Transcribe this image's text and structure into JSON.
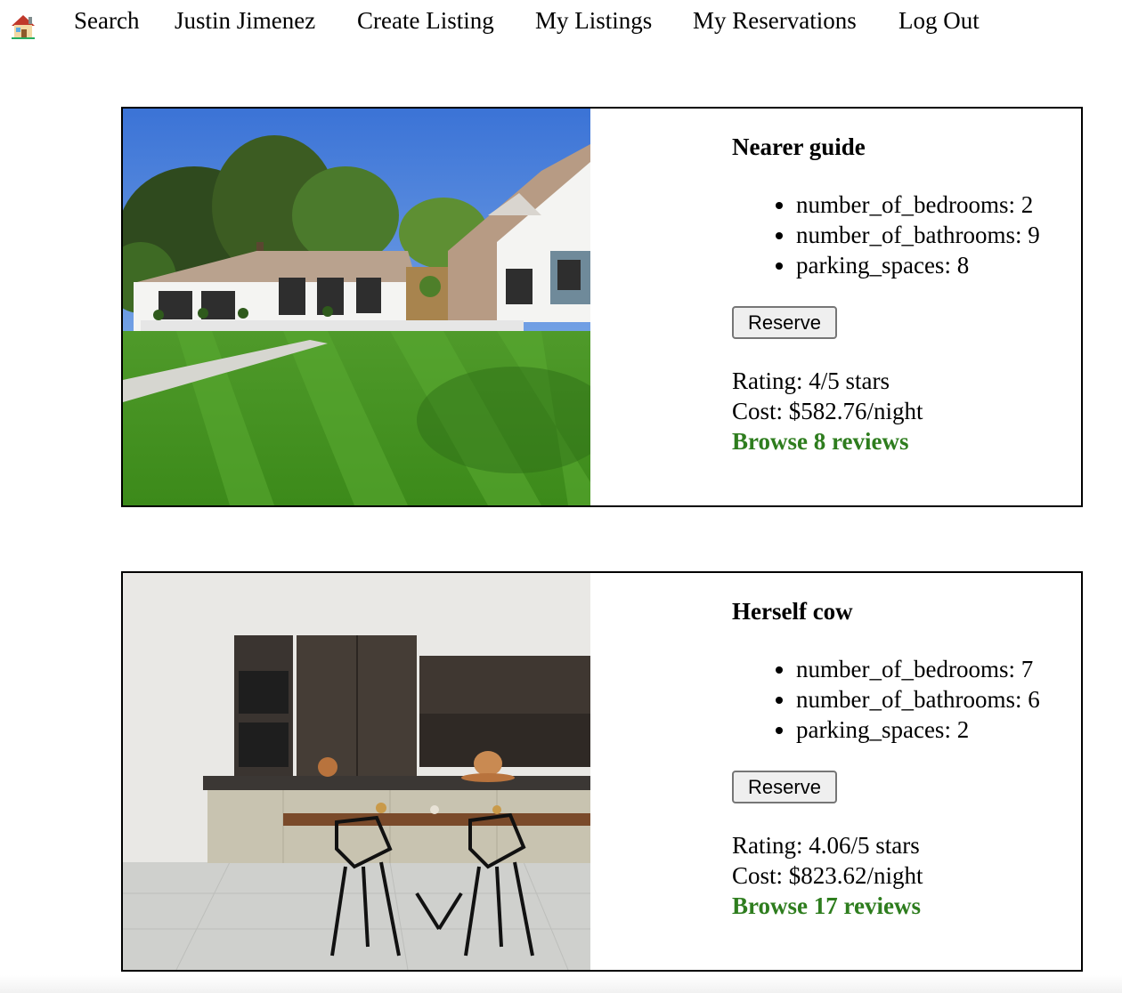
{
  "nav": {
    "home_icon": "house-emoji-icon",
    "items": [
      {
        "label": "Search"
      },
      {
        "label": "Justin Jimenez"
      },
      {
        "label": "Create Listing"
      },
      {
        "label": "My Listings"
      },
      {
        "label": "My Reservations"
      },
      {
        "label": "Log Out"
      }
    ]
  },
  "listings": [
    {
      "image": "house-with-lawn-photo",
      "title": "Nearer guide",
      "features": [
        "number_of_bedrooms: 2",
        "number_of_bathrooms: 9",
        "parking_spaces: 8"
      ],
      "reserve_label": "Reserve",
      "rating": "Rating: 4/5 stars",
      "cost": "Cost: $582.76/night",
      "reviews_link": "Browse 8 reviews"
    },
    {
      "image": "kitchen-interior-photo",
      "title": "Herself cow",
      "features": [
        "number_of_bedrooms: 7",
        "number_of_bathrooms: 6",
        "parking_spaces: 2"
      ],
      "reserve_label": "Reserve",
      "rating": "Rating: 4.06/5 stars",
      "cost": "Cost: $823.62/night",
      "reviews_link": "Browse 17 reviews"
    }
  ],
  "colors": {
    "link_green": "#2e7d1e",
    "card_border": "#000000",
    "button_bg": "#efefef",
    "button_border": "#767676"
  }
}
